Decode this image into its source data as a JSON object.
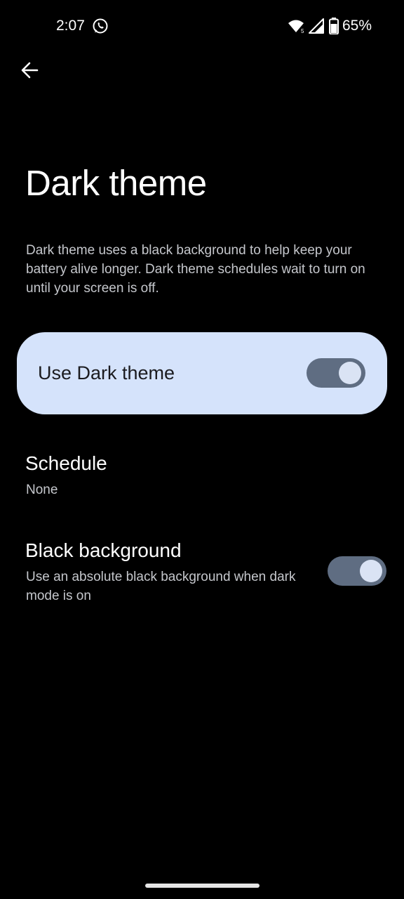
{
  "status_bar": {
    "time": "2:07",
    "notification_icon": "whatsapp-icon",
    "wifi_icon": "wifi-icon",
    "signal_icon": "signal-icon",
    "battery_icon": "battery-icon",
    "battery_percent": "65%"
  },
  "header": {
    "back_icon": "arrow-back-icon",
    "title": "Dark theme"
  },
  "description": "Dark theme uses a black background to help keep your battery alive longer. Dark theme schedules wait to turn on until your screen is off.",
  "main_toggle": {
    "label": "Use Dark theme",
    "state": "on"
  },
  "settings": {
    "schedule": {
      "title": "Schedule",
      "value": "None"
    },
    "black_background": {
      "title": "Black background",
      "summary": "Use an absolute black background when dark mode is on",
      "state": "on"
    }
  },
  "colors": {
    "background": "#000000",
    "card": "#d5e3fb",
    "switch_track": "#5f6d82",
    "switch_thumb": "#dae3f4",
    "secondary_text": "#c5c7cc"
  }
}
